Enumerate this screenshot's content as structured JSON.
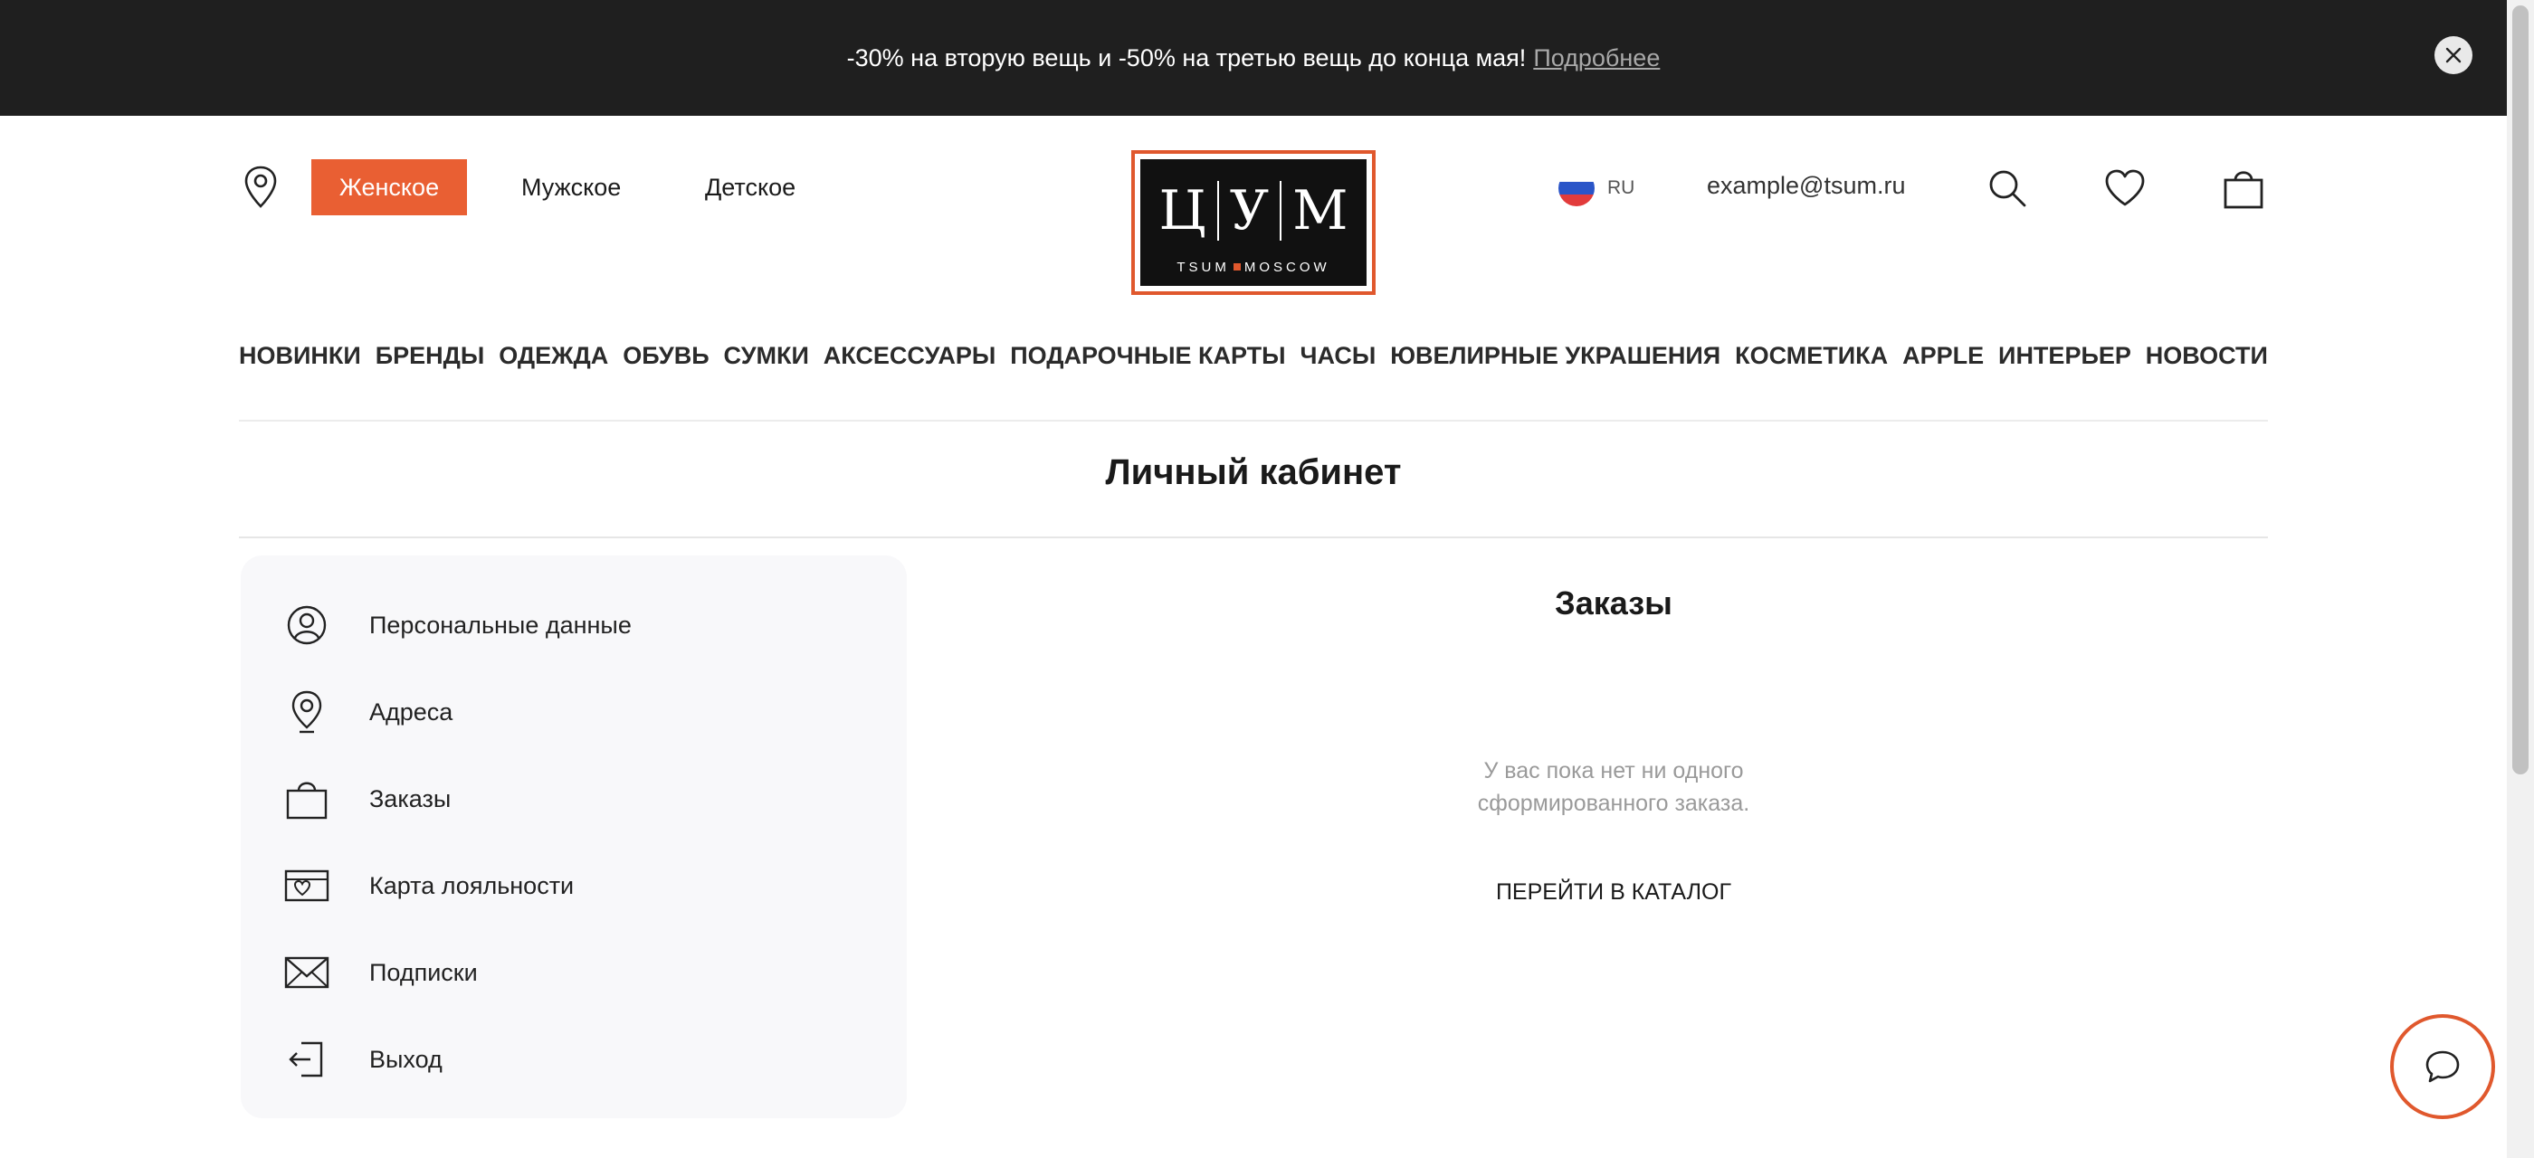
{
  "promo": {
    "text": "-30% на вторую вещь и -50% на третью вещь до конца мая!",
    "link": "Подробнее"
  },
  "header": {
    "genders": [
      "Женское",
      "Мужское",
      "Детское"
    ],
    "active_gender": "Женское",
    "logo": {
      "letters": [
        "Ц",
        "У",
        "М"
      ],
      "sub_left": "TSUM",
      "sub_right": "MOSCOW"
    },
    "lang": "RU",
    "email": "example@tsum.ru"
  },
  "catnav": [
    "НОВИНКИ",
    "БРЕНДЫ",
    "ОДЕЖДА",
    "ОБУВЬ",
    "СУМКИ",
    "АКСЕССУАРЫ",
    "ПОДАРОЧНЫЕ КАРТЫ",
    "ЧАСЫ",
    "ЮВЕЛИРНЫЕ УКРАШЕНИЯ",
    "КОСМЕТИКА",
    "APPLE",
    "ИНТЕРЬЕР",
    "НОВОСТИ"
  ],
  "page_title": "Личный кабинет",
  "sidebar": {
    "items": [
      {
        "label": "Персональные данные",
        "icon": "user-icon"
      },
      {
        "label": "Адреса",
        "icon": "location-pin-icon"
      },
      {
        "label": "Заказы",
        "icon": "shopping-bag-icon"
      },
      {
        "label": "Карта лояльности",
        "icon": "loyalty-card-icon"
      },
      {
        "label": "Подписки",
        "icon": "envelope-icon"
      },
      {
        "label": "Выход",
        "icon": "logout-icon"
      }
    ]
  },
  "main": {
    "title": "Заказы",
    "empty_line1": "У вас пока нет ни одного",
    "empty_line2": "сформированного заказа.",
    "catalog_link": "ПЕРЕЙТИ В КАТАЛОГ"
  },
  "colors": {
    "accent": "#e95f33",
    "banner": "#1f1f1f",
    "sidebar_bg": "#f8f8fa"
  }
}
